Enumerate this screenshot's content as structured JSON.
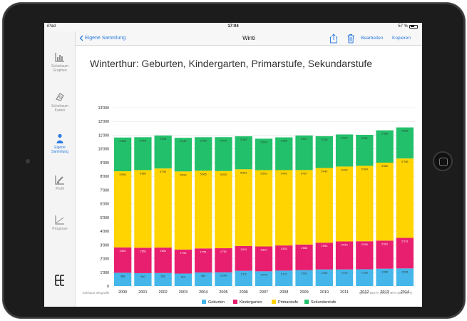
{
  "status": {
    "device": "iPad",
    "time": "17:04",
    "battery": "57 %",
    "battery_level": 0.57
  },
  "nav": {
    "back_label": "Eigene Sammlung",
    "title": "Winti",
    "edit_label": "Bearbeiten",
    "copy_label": "Kopieren",
    "icons": [
      "share-icon",
      "trash-icon"
    ]
  },
  "sidebar": {
    "items": [
      {
        "label_line1": "Schulraum",
        "label_line2": "Graphen",
        "icon": "bar-chart-icon",
        "active": false
      },
      {
        "label_line1": "Schulraum",
        "label_line2": "Karten",
        "icon": "map-pin-icon",
        "active": false
      },
      {
        "label_line1": "Eigene",
        "label_line2": "Sammlung",
        "icon": "person-icon",
        "active": true
      },
      {
        "label_line1": "Profil",
        "label_line2": "",
        "icon": "edit-chart-icon",
        "active": false
      },
      {
        "label_line1": "Prognose",
        "label_line2": "",
        "icon": "line-chart-icon",
        "active": false
      }
    ],
    "logo_icon": "eckhaus-logo-icon"
  },
  "footer": {
    "left": "Eckhaus Infografik",
    "right": "Quelle: BISTA (SOL); BFS (BEVNAT)"
  },
  "colors": {
    "geburten": "#44b6ea",
    "kindergarten": "#e81f6e",
    "primarstufe": "#ffd400",
    "sekundarstufe": "#22c06a",
    "accent": "#2a7ae2"
  },
  "chart_data": {
    "type": "bar",
    "stacked": true,
    "title": "Winterthur: Geburten, Kindergarten, Primarstufe, Sekundarstufe",
    "categories": [
      "2000",
      "2001",
      "2002",
      "2003",
      "2004",
      "2005",
      "2006",
      "2007",
      "2008",
      "2009",
      "2010",
      "2011",
      "2012",
      "2013",
      "2014"
    ],
    "ylim": [
      0,
      13000
    ],
    "yticks": [
      0,
      1000,
      2000,
      3000,
      4000,
      5000,
      6000,
      7000,
      8000,
      9000,
      10000,
      11000,
      12000,
      13000
    ],
    "ytick_labels": [
      "0",
      "1'000",
      "2'000",
      "3'000",
      "4'000",
      "5'000",
      "6'000",
      "7'000",
      "8'000",
      "9'000",
      "10'000",
      "11'000",
      "12'000",
      "13'000"
    ],
    "grid": true,
    "legend": "bottom",
    "series": [
      {
        "name": "Geburten",
        "values": [
          968,
          940,
          951,
          912,
          992,
          1004,
          1111,
          1076,
          1127,
          1161,
          1209,
          1212,
          1225,
          1263,
          1284
        ],
        "labels": [
          "968",
          "940",
          "951",
          "912",
          "992",
          "1'004",
          "1'111",
          "1'076",
          "1'127",
          "1'161",
          "1'209",
          "1'212",
          "1'225",
          "1'263",
          "1'284"
        ]
      },
      {
        "name": "Kindergarten",
        "values": [
          1851,
          1851,
          1851,
          1752,
          1751,
          1751,
          1810,
          1810,
          1832,
          1866,
          1953,
          2040,
          2040,
          2051,
          2231
        ],
        "labels": [
          "1'851",
          "1'851",
          "1'851",
          "1'752",
          "1'751",
          "1'751",
          "1'810",
          "1'810",
          "1'832",
          "1'866",
          "1'953",
          "2'040",
          "2'040",
          "2'051",
          "2'231"
        ]
      },
      {
        "name": "Primarstufe",
        "values": [
          5550,
          5660,
          5769,
          5693,
          5665,
          5629,
          5593,
          5563,
          5491,
          5427,
          5443,
          5462,
          5499,
          5682,
          5785
        ],
        "labels": [
          "5'550",
          "5'660",
          "5'769",
          "5'693",
          "5'665",
          "5'629",
          "5'593",
          "5'563",
          "5'491",
          "5'427",
          "5'443",
          "5'462",
          "5'499",
          "5'682",
          "5'785"
        ]
      },
      {
        "name": "Sekundarstufe",
        "values": [
          2458,
          2400,
          2400,
          2449,
          2443,
          2470,
          2402,
          2292,
          2389,
          2517,
          2316,
          2337,
          2261,
          2356,
          2265
        ],
        "labels": [
          "2'458",
          "2'400",
          "2'400",
          "2'449",
          "2'443",
          "2'470",
          "2'402",
          "2'292",
          "2'389",
          "2'517",
          "2'316",
          "2'337",
          "2'261",
          "2'356",
          "2'265"
        ]
      }
    ]
  }
}
